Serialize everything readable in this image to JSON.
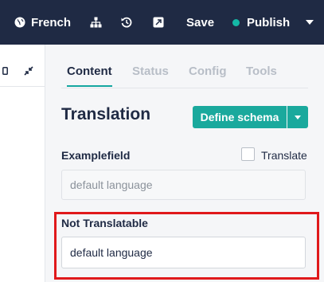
{
  "topbar": {
    "language_label": "French",
    "save_label": "Save",
    "publish_label": "Publish"
  },
  "tabs": [
    "Content",
    "Status",
    "Config",
    "Tools"
  ],
  "main": {
    "title": "Translation",
    "define_schema_label": "Define schema"
  },
  "fields": {
    "example": {
      "label": "Examplefield",
      "translate_label": "Translate",
      "translate_checked": false,
      "value": "default language"
    },
    "not_translatable": {
      "label": "Not Translatable",
      "value": "default language"
    }
  },
  "colors": {
    "topbar": "#1f2a44",
    "accent": "#1aa99d",
    "highlight": "#e0191b"
  }
}
